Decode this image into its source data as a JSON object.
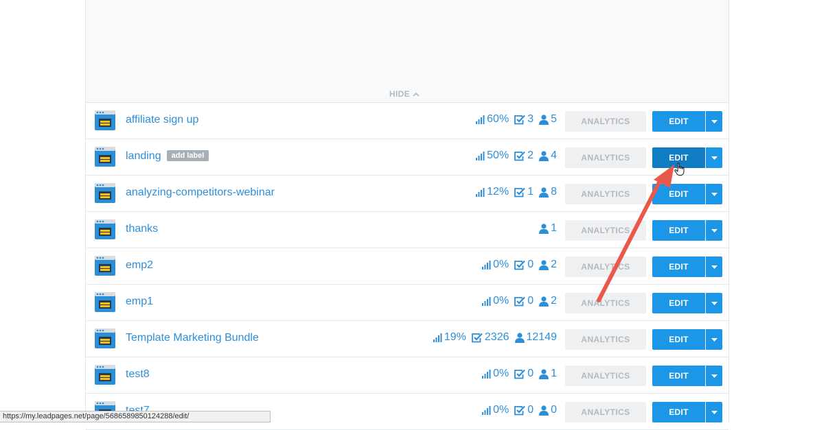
{
  "hide_toggle": {
    "label": "HIDE"
  },
  "buttons": {
    "analytics": "ANALYTICS",
    "edit": "EDIT",
    "add_label": "add label"
  },
  "rows": [
    {
      "name": "affiliate sign up",
      "conversion": "60%",
      "checks": "3",
      "visitors": "5"
    },
    {
      "name": "landing",
      "conversion": "50%",
      "checks": "2",
      "visitors": "4",
      "label_button": "add label",
      "edit_hover": true
    },
    {
      "name": "analyzing-competitors-webinar",
      "conversion": "12%",
      "checks": "1",
      "visitors": "8"
    },
    {
      "name": "thanks",
      "visitors": "1"
    },
    {
      "name": "emp2",
      "conversion": "0%",
      "checks": "0",
      "visitors": "2"
    },
    {
      "name": "emp1",
      "conversion": "0%",
      "checks": "0",
      "visitors": "2"
    },
    {
      "name": "Template Marketing Bundle",
      "conversion": "19%",
      "checks": "2326",
      "visitors": "12149"
    },
    {
      "name": "test8",
      "conversion": "0%",
      "checks": "0",
      "visitors": "1"
    },
    {
      "name": "test7",
      "conversion": "0%",
      "checks": "0",
      "visitors": "0"
    }
  ],
  "status_bar": {
    "url": "https://my.leadpages.net/page/5686589850124288/edit/"
  },
  "colors": {
    "link_blue": "#2d8ed8",
    "edit_blue": "#1c97e8",
    "edit_blue_hover": "#0f7cc3",
    "annotation_arrow": "#e8594c"
  },
  "icons": [
    "page-thumbnail-icon",
    "signal-bars-icon",
    "checkbox-icon",
    "user-icon",
    "caret-down-icon",
    "chevron-up-icon",
    "hand-cursor-icon"
  ]
}
